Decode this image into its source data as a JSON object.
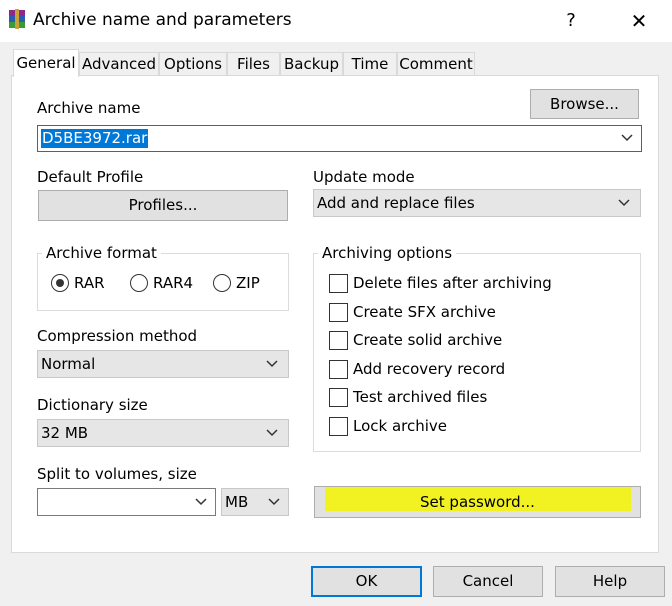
{
  "window": {
    "title": "Archive name and parameters",
    "help_glyph": "?",
    "close_glyph": "✕"
  },
  "tabs": [
    {
      "label": "General",
      "active": true
    },
    {
      "label": "Advanced"
    },
    {
      "label": "Options"
    },
    {
      "label": "Files"
    },
    {
      "label": "Backup"
    },
    {
      "label": "Time"
    },
    {
      "label": "Comment"
    }
  ],
  "archive_name": {
    "label": "Archive name",
    "value": "D5BE3972.rar",
    "browse_label": "Browse..."
  },
  "default_profile": {
    "label": "Default Profile",
    "button_label": "Profiles..."
  },
  "update_mode": {
    "label": "Update mode",
    "value": "Add and replace files"
  },
  "archive_format": {
    "label": "Archive format",
    "options": [
      "RAR",
      "RAR4",
      "ZIP"
    ],
    "selected": "RAR"
  },
  "compression_method": {
    "label": "Compression method",
    "value": "Normal"
  },
  "dictionary_size": {
    "label": "Dictionary size",
    "value": "32 MB"
  },
  "split_volumes": {
    "label": "Split to volumes, size",
    "value": "",
    "unit": "MB"
  },
  "archiving_options": {
    "label": "Archiving options",
    "items": [
      {
        "label": "Delete files after archiving",
        "checked": false
      },
      {
        "label": "Create SFX archive",
        "checked": false
      },
      {
        "label": "Create solid archive",
        "checked": false
      },
      {
        "label": "Add recovery record",
        "checked": false
      },
      {
        "label": "Test archived files",
        "checked": false
      },
      {
        "label": "Lock archive",
        "checked": false
      }
    ]
  },
  "set_password_label": "Set password...",
  "buttons": {
    "ok": "OK",
    "cancel": "Cancel",
    "help": "Help"
  },
  "colors": {
    "highlight": "#f5f500",
    "selection": "#0078d7",
    "focus_border": "#0078d7"
  }
}
